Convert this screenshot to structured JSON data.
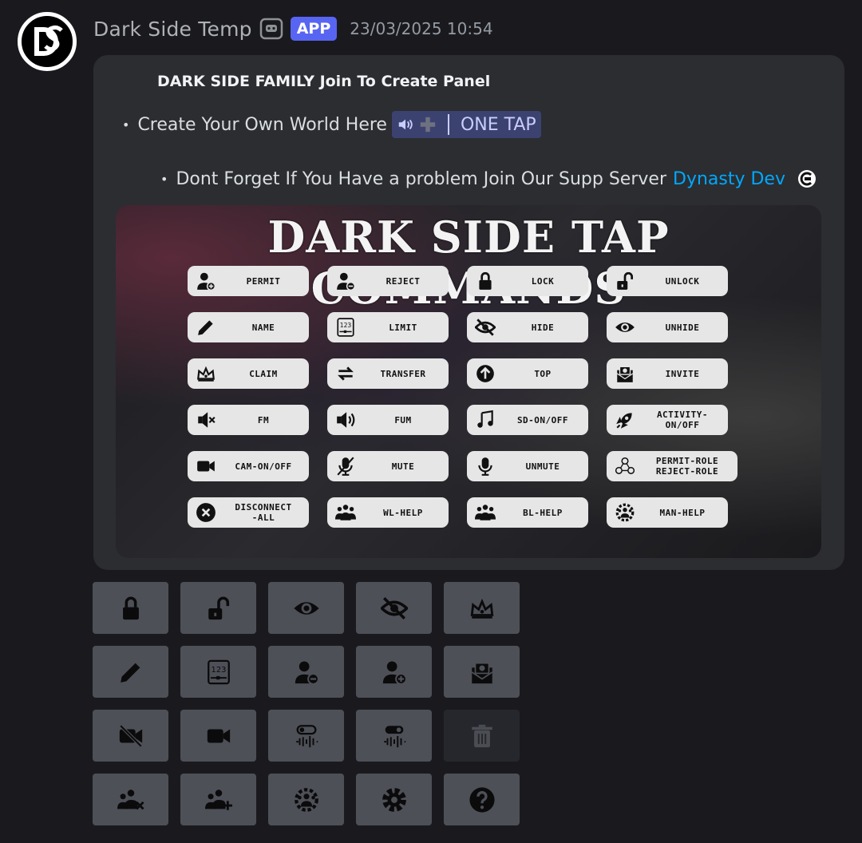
{
  "message": {
    "author": "Dark Side Temp",
    "badge": "APP",
    "timestamp": "23/03/2025 10:54",
    "avatar_initials": "DS"
  },
  "embed": {
    "title": "DARK SIDE FAMILY Join To Create Panel",
    "line1_text": "Create Your Own World Here",
    "channel_mention": "ONE TAP",
    "line2_text": "Dont Forget If You Have a problem Join Our Supp Server",
    "link_text": "Dynasty Dev"
  },
  "banner": {
    "title": "DARK SIDE TAP COMMANDS",
    "commands": [
      {
        "label": "PERMIT",
        "icon": "user-plus-icon"
      },
      {
        "label": "REJECT",
        "icon": "user-minus-icon"
      },
      {
        "label": "LOCK",
        "icon": "lock-icon"
      },
      {
        "label": "UNLOCK",
        "icon": "unlock-icon"
      },
      {
        "label": "NAME",
        "icon": "pencil-icon"
      },
      {
        "label": "LIMIT",
        "icon": "limit-123-icon"
      },
      {
        "label": "HIDE",
        "icon": "eye-slash-icon"
      },
      {
        "label": "UNHIDE",
        "icon": "eye-icon"
      },
      {
        "label": "CLAIM",
        "icon": "crown-icon"
      },
      {
        "label": "TRANSFER",
        "icon": "transfer-icon"
      },
      {
        "label": "TOP",
        "icon": "arrow-up-circle-icon"
      },
      {
        "label": "INVITE",
        "icon": "invite-icon"
      },
      {
        "label": "FM",
        "icon": "speaker-mute-icon"
      },
      {
        "label": "FUM",
        "icon": "speaker-icon"
      },
      {
        "label": "SD-ON/OFF",
        "icon": "music-note-icon"
      },
      {
        "label": "ACTIVITY-\nON/OFF",
        "icon": "rocket-icon"
      },
      {
        "label": "CAM-ON/OFF",
        "icon": "camera-icon"
      },
      {
        "label": "MUTE",
        "icon": "mic-slash-icon"
      },
      {
        "label": "UNMUTE",
        "icon": "mic-icon"
      },
      {
        "label": "PERMIT-ROLE\nREJECT-ROLE",
        "icon": "role-icon"
      },
      {
        "label": "DISCONNECT\n-ALL",
        "icon": "x-circle-icon"
      },
      {
        "label": "WL-HELP",
        "icon": "group-icon"
      },
      {
        "label": "BL-HELP",
        "icon": "group-icon"
      },
      {
        "label": "MAN-HELP",
        "icon": "group-gear-icon"
      }
    ]
  },
  "buttons": [
    [
      "lock-icon",
      "unlock-icon",
      "eye-icon",
      "eye-slash-icon",
      "crown-icon"
    ],
    [
      "pencil-icon",
      "limit-123-icon",
      "user-minus-icon",
      "user-plus-icon",
      "invite-icon"
    ],
    [
      "camera-off-icon",
      "camera-icon",
      "soundboard-on-icon",
      "soundboard-off-icon",
      "trash-icon"
    ],
    [
      "group-x-icon",
      "group-plus-icon",
      "group-gear-icon",
      "gear-icon",
      "question-icon"
    ]
  ],
  "colors": {
    "background": "#1a1a1e",
    "embed": "#2b2d31",
    "app_badge": "#5865f2",
    "link": "#00a8fc",
    "button": "#4e5058"
  }
}
